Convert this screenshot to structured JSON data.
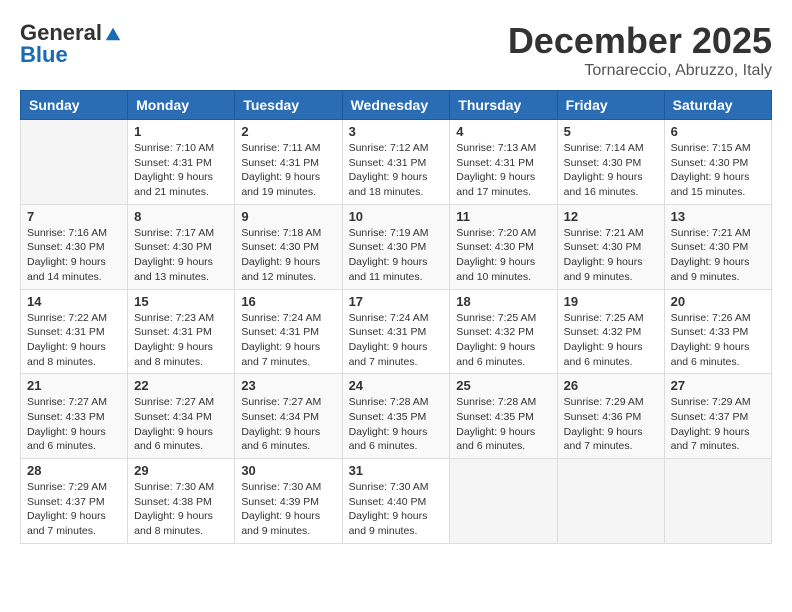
{
  "logo": {
    "general": "General",
    "blue": "Blue"
  },
  "header": {
    "month": "December 2025",
    "location": "Tornareccio, Abruzzo, Italy"
  },
  "weekdays": [
    "Sunday",
    "Monday",
    "Tuesday",
    "Wednesday",
    "Thursday",
    "Friday",
    "Saturday"
  ],
  "weeks": [
    [
      {
        "day": "",
        "info": ""
      },
      {
        "day": "1",
        "info": "Sunrise: 7:10 AM\nSunset: 4:31 PM\nDaylight: 9 hours\nand 21 minutes."
      },
      {
        "day": "2",
        "info": "Sunrise: 7:11 AM\nSunset: 4:31 PM\nDaylight: 9 hours\nand 19 minutes."
      },
      {
        "day": "3",
        "info": "Sunrise: 7:12 AM\nSunset: 4:31 PM\nDaylight: 9 hours\nand 18 minutes."
      },
      {
        "day": "4",
        "info": "Sunrise: 7:13 AM\nSunset: 4:31 PM\nDaylight: 9 hours\nand 17 minutes."
      },
      {
        "day": "5",
        "info": "Sunrise: 7:14 AM\nSunset: 4:30 PM\nDaylight: 9 hours\nand 16 minutes."
      },
      {
        "day": "6",
        "info": "Sunrise: 7:15 AM\nSunset: 4:30 PM\nDaylight: 9 hours\nand 15 minutes."
      }
    ],
    [
      {
        "day": "7",
        "info": "Sunrise: 7:16 AM\nSunset: 4:30 PM\nDaylight: 9 hours\nand 14 minutes."
      },
      {
        "day": "8",
        "info": "Sunrise: 7:17 AM\nSunset: 4:30 PM\nDaylight: 9 hours\nand 13 minutes."
      },
      {
        "day": "9",
        "info": "Sunrise: 7:18 AM\nSunset: 4:30 PM\nDaylight: 9 hours\nand 12 minutes."
      },
      {
        "day": "10",
        "info": "Sunrise: 7:19 AM\nSunset: 4:30 PM\nDaylight: 9 hours\nand 11 minutes."
      },
      {
        "day": "11",
        "info": "Sunrise: 7:20 AM\nSunset: 4:30 PM\nDaylight: 9 hours\nand 10 minutes."
      },
      {
        "day": "12",
        "info": "Sunrise: 7:21 AM\nSunset: 4:30 PM\nDaylight: 9 hours\nand 9 minutes."
      },
      {
        "day": "13",
        "info": "Sunrise: 7:21 AM\nSunset: 4:30 PM\nDaylight: 9 hours\nand 9 minutes."
      }
    ],
    [
      {
        "day": "14",
        "info": "Sunrise: 7:22 AM\nSunset: 4:31 PM\nDaylight: 9 hours\nand 8 minutes."
      },
      {
        "day": "15",
        "info": "Sunrise: 7:23 AM\nSunset: 4:31 PM\nDaylight: 9 hours\nand 8 minutes."
      },
      {
        "day": "16",
        "info": "Sunrise: 7:24 AM\nSunset: 4:31 PM\nDaylight: 9 hours\nand 7 minutes."
      },
      {
        "day": "17",
        "info": "Sunrise: 7:24 AM\nSunset: 4:31 PM\nDaylight: 9 hours\nand 7 minutes."
      },
      {
        "day": "18",
        "info": "Sunrise: 7:25 AM\nSunset: 4:32 PM\nDaylight: 9 hours\nand 6 minutes."
      },
      {
        "day": "19",
        "info": "Sunrise: 7:25 AM\nSunset: 4:32 PM\nDaylight: 9 hours\nand 6 minutes."
      },
      {
        "day": "20",
        "info": "Sunrise: 7:26 AM\nSunset: 4:33 PM\nDaylight: 9 hours\nand 6 minutes."
      }
    ],
    [
      {
        "day": "21",
        "info": "Sunrise: 7:27 AM\nSunset: 4:33 PM\nDaylight: 9 hours\nand 6 minutes."
      },
      {
        "day": "22",
        "info": "Sunrise: 7:27 AM\nSunset: 4:34 PM\nDaylight: 9 hours\nand 6 minutes."
      },
      {
        "day": "23",
        "info": "Sunrise: 7:27 AM\nSunset: 4:34 PM\nDaylight: 9 hours\nand 6 minutes."
      },
      {
        "day": "24",
        "info": "Sunrise: 7:28 AM\nSunset: 4:35 PM\nDaylight: 9 hours\nand 6 minutes."
      },
      {
        "day": "25",
        "info": "Sunrise: 7:28 AM\nSunset: 4:35 PM\nDaylight: 9 hours\nand 6 minutes."
      },
      {
        "day": "26",
        "info": "Sunrise: 7:29 AM\nSunset: 4:36 PM\nDaylight: 9 hours\nand 7 minutes."
      },
      {
        "day": "27",
        "info": "Sunrise: 7:29 AM\nSunset: 4:37 PM\nDaylight: 9 hours\nand 7 minutes."
      }
    ],
    [
      {
        "day": "28",
        "info": "Sunrise: 7:29 AM\nSunset: 4:37 PM\nDaylight: 9 hours\nand 7 minutes."
      },
      {
        "day": "29",
        "info": "Sunrise: 7:30 AM\nSunset: 4:38 PM\nDaylight: 9 hours\nand 8 minutes."
      },
      {
        "day": "30",
        "info": "Sunrise: 7:30 AM\nSunset: 4:39 PM\nDaylight: 9 hours\nand 9 minutes."
      },
      {
        "day": "31",
        "info": "Sunrise: 7:30 AM\nSunset: 4:40 PM\nDaylight: 9 hours\nand 9 minutes."
      },
      {
        "day": "",
        "info": ""
      },
      {
        "day": "",
        "info": ""
      },
      {
        "day": "",
        "info": ""
      }
    ]
  ]
}
